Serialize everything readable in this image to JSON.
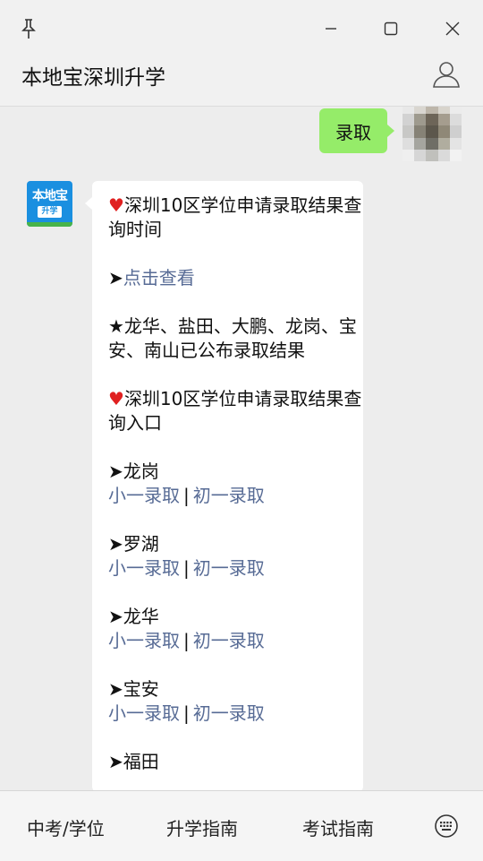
{
  "header": {
    "title": "本地宝深圳升学"
  },
  "outgoing": {
    "text": "录取"
  },
  "bot": {
    "logo_text": "本地宝",
    "logo_sub": "升学"
  },
  "message": {
    "p1": "深圳10区学位申请录取结果查询时间",
    "p2_arrow": "➤",
    "p2_link": "点击查看",
    "p3": "★龙华、盐田、大鹏、龙岗、宝安、南山已公布录取结果",
    "p4": "深圳10区学位申请录取结果查询入口",
    "districts": [
      {
        "name": "龙岗",
        "link1": "小一录取",
        "link2": "初一录取"
      },
      {
        "name": "罗湖",
        "link1": "小一录取",
        "link2": "初一录取"
      },
      {
        "name": "龙华",
        "link1": "小一录取",
        "link2": "初一录取"
      },
      {
        "name": "宝安",
        "link1": "小一录取",
        "link2": "初一录取"
      },
      {
        "name": "福田",
        "link1": "",
        "link2": ""
      }
    ],
    "arrow": "➤",
    "divider": "|",
    "heart": "♥"
  },
  "menu": {
    "item1": "中考/学位",
    "item2": "升学指南",
    "item3": "考试指南"
  },
  "colors": {
    "link": "#576b95",
    "bubble_out": "#95ec69",
    "heart": "#e02020"
  }
}
